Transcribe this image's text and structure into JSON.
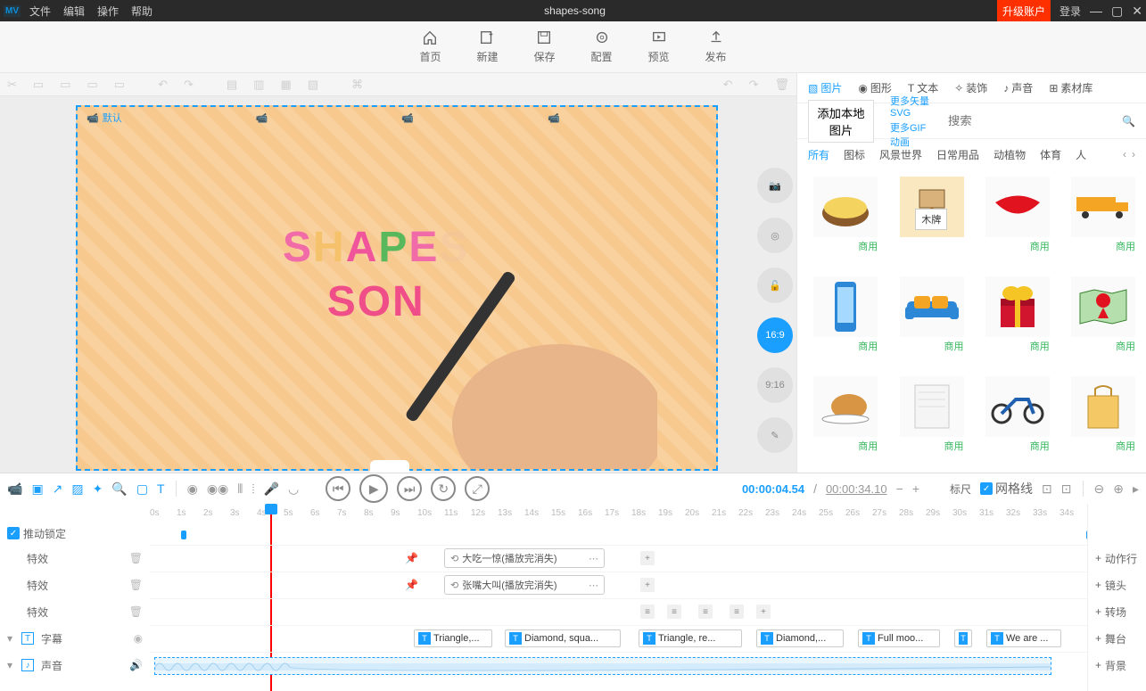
{
  "titlebar": {
    "logo": "MV",
    "menus": [
      "文件",
      "编辑",
      "操作",
      "帮助"
    ],
    "title": "shapes-song",
    "upgrade": "升级账户",
    "login": "登录"
  },
  "toolbar": {
    "items": [
      {
        "label": "首页",
        "icon": "home"
      },
      {
        "label": "新建",
        "icon": "new"
      },
      {
        "label": "保存",
        "icon": "save"
      },
      {
        "label": "配置",
        "icon": "settings"
      },
      {
        "label": "预览",
        "icon": "preview"
      },
      {
        "label": "发布",
        "icon": "publish"
      }
    ]
  },
  "canvas": {
    "cams": [
      "默认",
      "",
      "",
      ""
    ],
    "text_line1": [
      "S",
      "H",
      "A",
      "P",
      "E",
      "S"
    ],
    "text_line2": "SON",
    "ratios": [
      "16:9",
      "9:16"
    ]
  },
  "right": {
    "tabs": [
      "图片",
      "图形",
      "文本",
      "装饰",
      "声音",
      "素材库"
    ],
    "add_local": "添加本地图片",
    "link_svg": "更多矢量SVG",
    "link_gif": "更多GIF动画",
    "search_ph": "搜索",
    "cats": [
      "所有",
      "图标",
      "风景世界",
      "日常用品",
      "动植物",
      "体育",
      "人"
    ],
    "tooltip": "木牌",
    "asset_tag": "商用"
  },
  "timeline": {
    "time_cur": "00:00:04.54",
    "time_tot": "00:00:34.10",
    "ruler_label": "标尺",
    "grid_label": "网格线",
    "lock_label": "推动锁定",
    "rows": {
      "fx": "特效",
      "subtitle": "字幕",
      "sound": "声音"
    },
    "clips": {
      "c1": "大吃一惊(播放完消失)",
      "c2": "张嘴大叫(播放完消失)"
    },
    "subs": [
      "Triangle,...",
      "Diamond, squa...",
      "Triangle, re...",
      "Diamond,...",
      "Full moo...",
      "",
      "We are ..."
    ],
    "actions": [
      "动作行",
      "镜头",
      "转场",
      "舞台",
      "背景"
    ]
  },
  "ruler_ticks": [
    "0s",
    "1s",
    "2s",
    "3s",
    "4s",
    "5s",
    "6s",
    "7s",
    "8s",
    "9s",
    "10s",
    "11s",
    "12s",
    "13s",
    "14s",
    "15s",
    "16s",
    "17s",
    "18s",
    "19s",
    "20s",
    "21s",
    "22s",
    "23s",
    "24s",
    "25s",
    "26s",
    "27s",
    "28s",
    "29s",
    "30s",
    "31s",
    "32s",
    "33s",
    "34s"
  ]
}
